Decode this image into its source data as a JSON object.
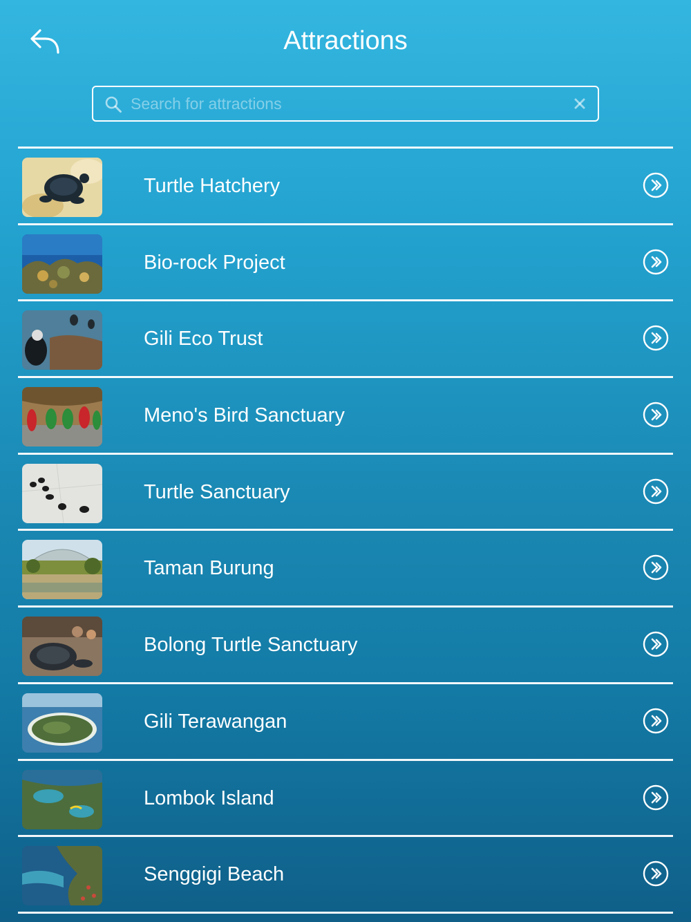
{
  "header": {
    "title": "Attractions",
    "back_icon": "back-reply-arrow-icon"
  },
  "search": {
    "placeholder": "Search for attractions",
    "value": "",
    "icon": "search-icon",
    "clear_icon": "clear-x-icon"
  },
  "attractions": [
    {
      "label": "Turtle Hatchery",
      "thumb": "turtle-hatchery-photo"
    },
    {
      "label": "Bio-rock Project",
      "thumb": "coral-reef-photo"
    },
    {
      "label": "Gili Eco Trust",
      "thumb": "divers-photo"
    },
    {
      "label": "Meno's Bird Sanctuary",
      "thumb": "parrots-photo"
    },
    {
      "label": "Turtle Sanctuary",
      "thumb": "baby-turtles-photo"
    },
    {
      "label": "Taman Burung",
      "thumb": "bird-park-photo"
    },
    {
      "label": "Bolong Turtle Sanctuary",
      "thumb": "sea-turtle-photo"
    },
    {
      "label": "Gili Terawangan",
      "thumb": "island-aerial-photo"
    },
    {
      "label": "Lombok Island",
      "thumb": "lombok-coast-photo"
    },
    {
      "label": "Senggigi Beach",
      "thumb": "senggigi-coast-photo"
    }
  ],
  "row_action_icon": "chevron-right-circle-icon",
  "colors": {
    "background_top": "#33b6e0",
    "background_bottom": "#0f5f88",
    "text": "#ffffff"
  }
}
